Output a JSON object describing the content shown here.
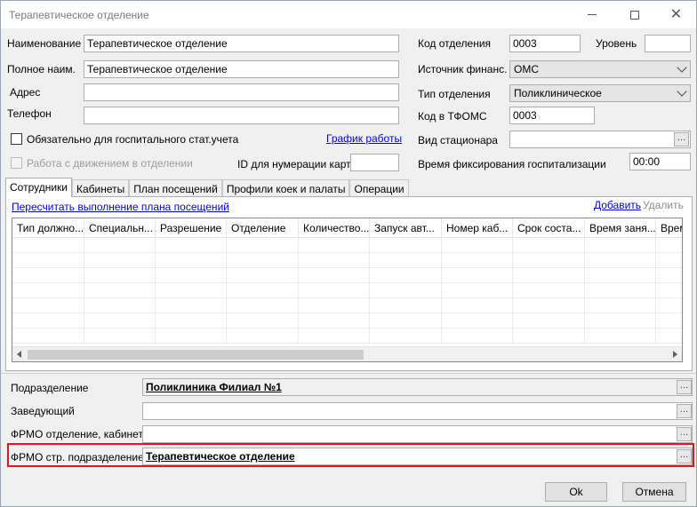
{
  "window": {
    "title": "Терапевтическое отделение"
  },
  "form": {
    "name_label": "Наименование",
    "name_value": "Терапевтическое отделение",
    "fullname_label": "Полное наим.",
    "fullname_value": "Терапевтическое отделение",
    "address_label": "Адрес",
    "address_value": "",
    "phone_label": "Телефон",
    "phone_value": "",
    "hospital_check_label": "Обязательно для госпитального стат.учета",
    "schedule_link": "График работы",
    "movement_check_label": "Работа с движением в отделении",
    "card_id_label": "ID для нумерации карт",
    "card_id_value": "",
    "code_label": "Код отделения",
    "code_value": "0003",
    "level_label": "Уровень",
    "level_value": "",
    "fin_source_label": "Источник финанс.",
    "fin_source_value": "ОМС",
    "dept_type_label": "Тип отделения",
    "dept_type_value": "Поликлиническое",
    "tfoms_code_label": "Код в ТФОМС",
    "tfoms_code_value": "0003",
    "inpatient_type_label": "Вид стационара",
    "inpatient_type_value": "",
    "fix_time_label": "Время фиксирования госпитализации",
    "fix_time_value": "00:00"
  },
  "tabs": [
    {
      "label": "Сотрудники"
    },
    {
      "label": "Кабинеты"
    },
    {
      "label": "План посещений"
    },
    {
      "label": "Профили коек и палаты"
    },
    {
      "label": "Операции"
    }
  ],
  "staff": {
    "recalc_link": "Пересчитать выполнение плана посещений",
    "add_link": "Добавить",
    "delete_link": "Удалить",
    "columns": [
      "Тип должно...",
      "Специальн...",
      "Разрешение",
      "Отделение",
      "Количество...",
      "Запуск авт...",
      "Номер каб...",
      "Срок соста...",
      "Время заня...",
      "Время"
    ]
  },
  "bottom": {
    "division_label": "Подразделение",
    "division_value": "Поликлиника Филиал №1",
    "head_label": "Заведующий",
    "head_value": "",
    "frmo_cabinet_label": "ФРМО отделение, кабинет",
    "frmo_cabinet_value": "",
    "frmo_struct_label": "ФРМО стр. подразделение",
    "frmo_struct_value": "Терапевтическое отделение"
  },
  "buttons": {
    "ok": "Ok",
    "cancel": "Отмена"
  },
  "colors": {
    "highlight": "#e3161b",
    "link": "#0000ee"
  }
}
